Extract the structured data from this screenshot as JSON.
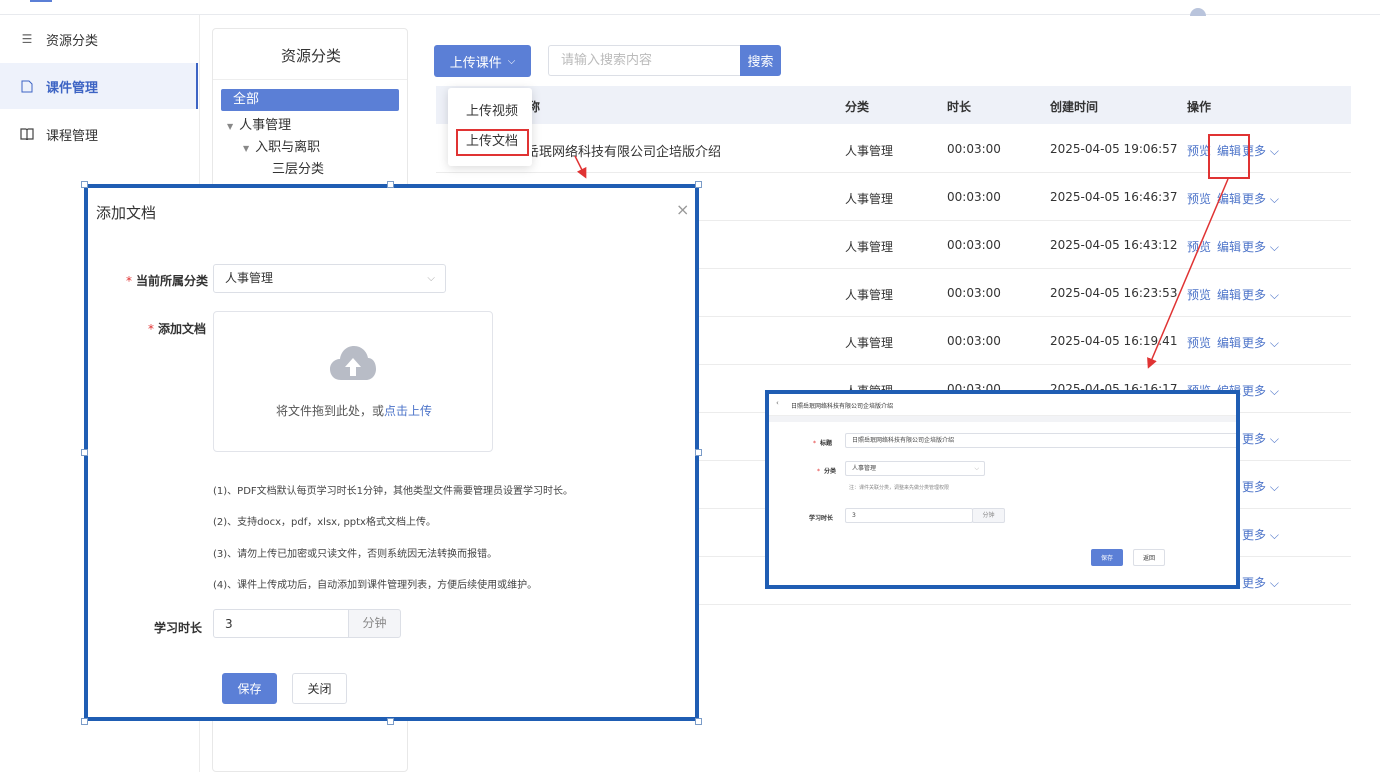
{
  "sidebar": {
    "items": [
      {
        "label": "资源分类",
        "icon": "list-icon"
      },
      {
        "label": "课件管理",
        "icon": "file-icon",
        "active": true
      },
      {
        "label": "课程管理",
        "icon": "book-icon"
      }
    ]
  },
  "category_panel": {
    "title": "资源分类",
    "tree": [
      {
        "label": "全部",
        "selected": true
      },
      {
        "label": "人事管理"
      },
      {
        "label": "入职与离职"
      },
      {
        "label": "三层分类"
      }
    ]
  },
  "toolbar": {
    "upload_label": "上传课件",
    "search_placeholder": "请输入搜索内容",
    "search_label": "搜索"
  },
  "upload_menu": {
    "items": [
      "上传视频",
      "上传文档"
    ]
  },
  "table": {
    "columns": [
      "称",
      "分类",
      "时长",
      "创建时间",
      "操作"
    ],
    "rows": [
      {
        "name": "岳珉网络科技有限公司企培版介绍",
        "category": "人事管理",
        "duration": "00:03:00",
        "created": "2025-04-05 19:06:57"
      },
      {
        "name": "",
        "category": "人事管理",
        "duration": "00:03:00",
        "created": "2025-04-05 16:46:37"
      },
      {
        "name": "",
        "category": "人事管理",
        "duration": "00:03:00",
        "created": "2025-04-05 16:43:12"
      },
      {
        "name": "",
        "category": "人事管理",
        "duration": "00:03:00",
        "created": "2025-04-05 16:23:53"
      },
      {
        "name": "",
        "category": "人事管理",
        "duration": "00:03:00",
        "created": "2025-04-05 16:19:41"
      },
      {
        "name": "",
        "category": "人事管理",
        "duration": "00:03:00",
        "created": "2025-04-05 16:16:17"
      }
    ],
    "actions": {
      "preview": "预览",
      "edit": "编辑",
      "more": "更多"
    }
  },
  "modal": {
    "title": "添加文档",
    "category_label": "当前所属分类",
    "category_value": "人事管理",
    "doc_label": "添加文档",
    "drop_text": "将文件拖到此处，或",
    "drop_link": "点击上传",
    "notes": [
      "(1)、PDF文档默认每页学习时长1分钟，其他类型文件需要管理员设置学习时长。",
      "(2)、支持docx，pdf，xlsx, pptx格式文档上传。",
      "(3)、请勿上传已加密或只读文件，否则系统因无法转换而报错。",
      "(4)、课件上传成功后，自动添加到课件管理列表，方便后续使用或维护。"
    ],
    "duration_label": "学习时长",
    "duration_value": "3",
    "duration_unit": "分钟",
    "save_label": "保存",
    "close_label": "关闭"
  },
  "edit_preview": {
    "header_title": "日照岳珉网络科技有限公司企培版介绍",
    "title_label": "标题",
    "title_value": "日照岳珉网络科技有限公司企培版介绍",
    "category_label": "分类",
    "category_value": "人事管理",
    "note": "注：课件关联分类，调整来先做分类管理权限",
    "duration_label": "学习时长",
    "duration_value": "3",
    "duration_unit": "分钟",
    "save_label": "保存",
    "back_label": "返回"
  },
  "colors": {
    "accent": "#5b7fd6",
    "highlight_box": "#1f5db3",
    "annotation_red": "#e03333"
  }
}
